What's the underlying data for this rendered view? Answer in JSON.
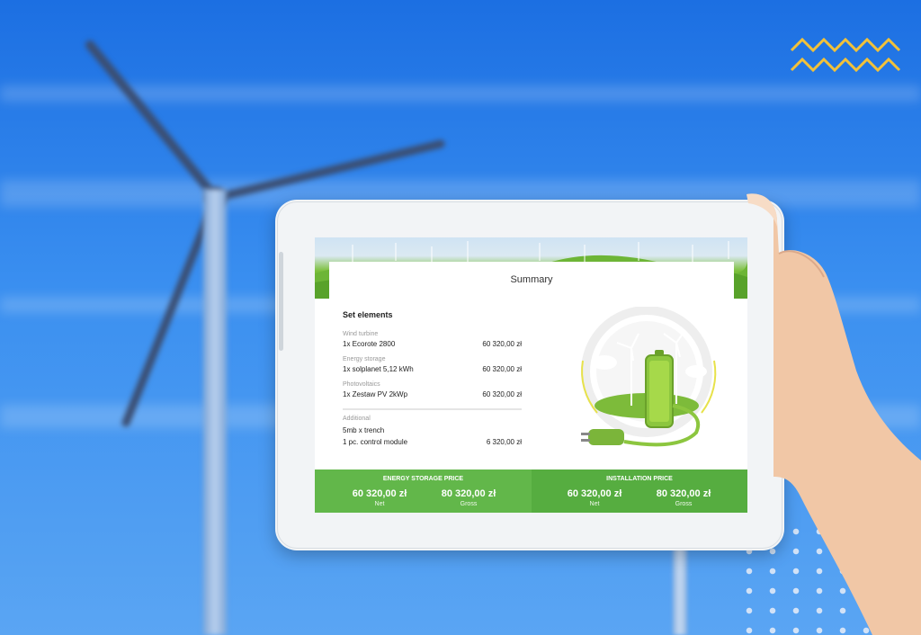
{
  "summary": {
    "title": "Summary",
    "set_elements_label": "Set elements",
    "items": [
      {
        "category": "Wind turbine",
        "name": "1x Ecorote 2800",
        "price": "60 320,00 zł"
      },
      {
        "category": "Energy storage",
        "name": "1x solplanet 5,12 kWh",
        "price": "60 320,00 zł"
      },
      {
        "category": "Photovoltaics",
        "name": "1x Zestaw PV 2kWp",
        "price": "60 320,00 zł"
      }
    ],
    "additional": {
      "category": "Additional",
      "lines": [
        {
          "name": "5mb x trench",
          "price": ""
        },
        {
          "name": "1 pc. control module",
          "price": "6 320,00 zł"
        }
      ]
    }
  },
  "pricing": {
    "energy_storage": {
      "title": "ENERGY STORAGE PRICE",
      "net_value": "60 320,00 zł",
      "net_label": "Net",
      "gross_value": "80 320,00 zł",
      "gross_label": "Gross"
    },
    "installation": {
      "title": "INSTALLATION PRICE",
      "net_value": "60 320,00 zł",
      "net_label": "Net",
      "gross_value": "80 320,00 zł",
      "gross_label": "Gross"
    }
  },
  "colors": {
    "sky": "#2f86ea",
    "price_bar_left": "#62b74a",
    "price_bar_right": "#56ad40",
    "zigzag": "#f2c23a",
    "battery": "#8cc63f"
  },
  "icons": [
    "wind-turbine-icon",
    "battery-icon",
    "power-plug-icon",
    "cloud-icon"
  ]
}
